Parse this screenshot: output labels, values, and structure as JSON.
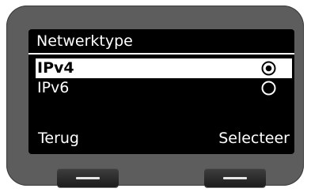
{
  "screen": {
    "title": "Netwerktype",
    "options": [
      {
        "label": "IPv4",
        "selected": true,
        "icon": "radio-selected-icon"
      },
      {
        "label": "IPv6",
        "selected": false,
        "icon": "radio-unselected-icon"
      }
    ]
  },
  "softkeys": {
    "left_label": "Terug",
    "right_label": "Selecteer"
  },
  "colors": {
    "device": "#5d5d5d",
    "screen_bg": "#000000",
    "screen_fg": "#ffffff"
  }
}
